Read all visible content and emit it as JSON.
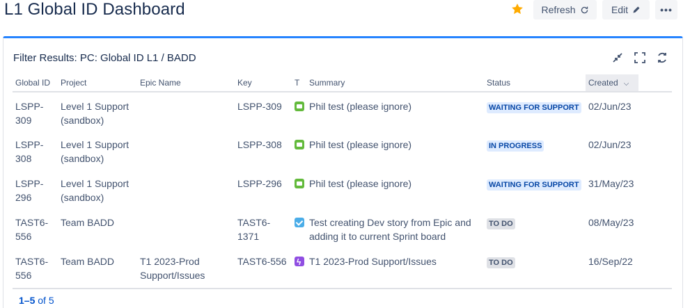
{
  "header": {
    "title": "L1 Global ID Dashboard",
    "refresh_label": "Refresh",
    "edit_label": "Edit",
    "more_label": "•••"
  },
  "gadget": {
    "title": "Filter Results: PC: Global ID L1 / BADD",
    "columns": [
      "Global ID",
      "Project",
      "Epic Name",
      "Key",
      "T",
      "Summary",
      "Status",
      "Created"
    ],
    "rows": [
      {
        "global_id": "LSPP-\n309",
        "project": "Level 1 Support\n(sandbox)",
        "epic": "",
        "key": "LSPP-309",
        "type_icon": "story-icon",
        "summary": "Phil test (please ignore)",
        "status": "WAITING FOR SUPPORT",
        "created": "02/Jun/23"
      },
      {
        "global_id": "LSPP-\n308",
        "project": "Level 1 Support\n(sandbox)",
        "epic": "",
        "key": "LSPP-308",
        "type_icon": "story-icon",
        "summary": "Phil test (please ignore)",
        "status": "IN PROGRESS",
        "created": "02/Jun/23"
      },
      {
        "global_id": "LSPP-\n296",
        "project": "Level 1 Support\n(sandbox)",
        "epic": "",
        "key": "LSPP-296",
        "type_icon": "story-icon",
        "summary": "Phil test (please ignore)",
        "status": "WAITING FOR SUPPORT",
        "created": "31/May/23"
      },
      {
        "global_id": "TAST6-\n556",
        "project": "Team BADD",
        "epic": "",
        "key": "TAST6-1371",
        "type_icon": "task-icon",
        "summary": "Test creating Dev story from Epic and\nadding it to current Sprint board",
        "status": "TO DO",
        "created": "08/May/23"
      },
      {
        "global_id": "TAST6-\n556",
        "project": "Team BADD",
        "epic": "T1 2023-Prod\nSupport/Issues",
        "key": "TAST6-556",
        "type_icon": "epic-icon",
        "summary": "T1 2023-Prod Support/Issues",
        "status": "TO DO",
        "created": "16/Sep/22"
      }
    ],
    "pager": {
      "range": "1–5",
      "of": "of",
      "total": "5"
    }
  },
  "colors": {
    "accent": "#2684ff",
    "link": "#0052cc",
    "star": "#ffab00"
  }
}
